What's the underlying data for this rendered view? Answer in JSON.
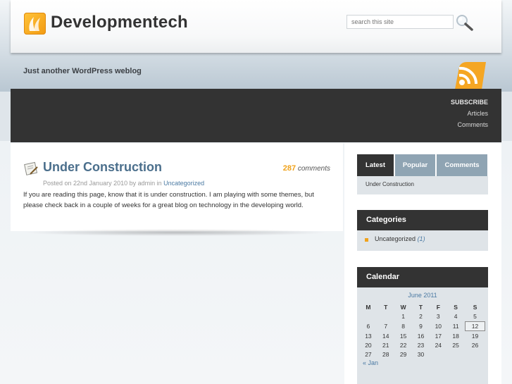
{
  "header": {
    "site_title": "Developmentech",
    "search_placeholder": "search this site",
    "tagline": "Just another WordPress weblog",
    "logo_icon": "flame-leaf-logo-icon",
    "search_icon": "magnifier-icon",
    "rss_icon": "rss-feed-icon"
  },
  "nav": {
    "subscribe": "SUBSCRIBE",
    "articles": "Articles",
    "comments": "Comments"
  },
  "post": {
    "title": "Under Construction",
    "comments_count": "287",
    "comments_label": "comments",
    "meta_prefix": "Posted on 22nd January 2010 by admin in ",
    "category": "Uncategorized",
    "body": "If you are reading this page, know that it is under construction. I am playing with some themes, but please check back in a couple of weeks for a great blog on technology in the developing world."
  },
  "sidebar": {
    "tabs": [
      "Latest",
      "Popular",
      "Comments"
    ],
    "latest_item": "Under Construction",
    "categories_title": "Categories",
    "category_item": "Uncategorized",
    "category_count": "(1)",
    "calendar_title": "Calendar",
    "calendar_month": "June 2011",
    "calendar_days": [
      "M",
      "T",
      "W",
      "T",
      "F",
      "S",
      "S"
    ],
    "calendar_weeks": [
      [
        "",
        "",
        "1",
        "2",
        "3",
        "4",
        "5"
      ],
      [
        "6",
        "7",
        "8",
        "9",
        "10",
        "11",
        "12"
      ],
      [
        "13",
        "14",
        "15",
        "16",
        "17",
        "18",
        "19"
      ],
      [
        "20",
        "21",
        "22",
        "23",
        "24",
        "25",
        "26"
      ],
      [
        "27",
        "28",
        "29",
        "30",
        "",
        "",
        ""
      ]
    ],
    "calendar_today": "12",
    "calendar_prev": "« Jan"
  },
  "colors": {
    "accent_orange": "#f0a21b",
    "link_blue": "#4b7aa3",
    "title_blue": "#4b6f8c",
    "dark_bar": "#333333",
    "tab_inactive": "#8fa4b3"
  }
}
